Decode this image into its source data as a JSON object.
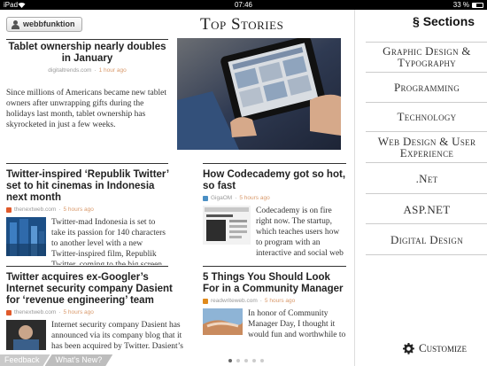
{
  "status_bar": {
    "carrier": "iPad",
    "time": "07:46",
    "battery": "33 %",
    "battery_level": 0.33
  },
  "header": {
    "user_button_label": "webbfunktion",
    "page_title": "Top Stories"
  },
  "top_story": {
    "title": "Tablet ownership nearly doubles in January",
    "source": "digitaltrends.com",
    "time_ago": "1 hour ago",
    "body": "Since millions of Americans became new tablet owners after unwrapping gifts during the holidays last month, tablet ownership has skyrocketed in just a few weeks."
  },
  "stories": [
    {
      "title": "Twitter-inspired ‘Republik Twitter’ set to hit cinemas in Indonesia next month",
      "source": "thenextweb.com",
      "time_ago": "5 hours ago",
      "body": "Twitter-mad Indonesia is set to take its passion for 140 characters to another level with a new Twitter-inspired film, Republik Twitter, coming to the big screen in the"
    },
    {
      "title": "How Codecademy got so hot, so fast",
      "source": "GigaOM",
      "time_ago": "5 hours ago",
      "body": "Codecademy is on fire right now. The startup, which teaches users how to program with an interactive and social web"
    },
    {
      "title": "Twitter acquires ex-Googler’s Internet security company Dasient for ‘revenue engineering’ team",
      "source": "thenextweb.com",
      "time_ago": "5 hours ago",
      "body": "Internet security company Dasient has announced via its company blog that it has been acquired by Twitter. Dasient’s team will"
    },
    {
      "title": "5 Things You Should Look For in a Community Manager",
      "source": "readwriteweb.com",
      "time_ago": "5 hours ago",
      "body": "In honor of Community Manager Day, I thought it would fun and worthwhile to share some tips with"
    }
  ],
  "sidebar": {
    "title": "Sections",
    "section_glyph": "§",
    "items": [
      {
        "label": "Graphic Design & Typography"
      },
      {
        "label": "Programming"
      },
      {
        "label": "Technology"
      },
      {
        "label": "Web Design & User Experience"
      },
      {
        "label": ".Net"
      },
      {
        "label": "ASP.NET"
      },
      {
        "label": "Digital Design"
      }
    ],
    "customize_label": "Customize"
  },
  "bottom": {
    "feedback_label": "Feedback",
    "whats_new_label": "What's New?",
    "page_count": 5,
    "current_page": 1
  },
  "colors": {
    "time_ago": "#d99a6c",
    "thenextweb_favicon": "#e05a2b",
    "gigaom_favicon": "#4a8fc4",
    "readwriteweb_favicon": "#e08a1c"
  }
}
